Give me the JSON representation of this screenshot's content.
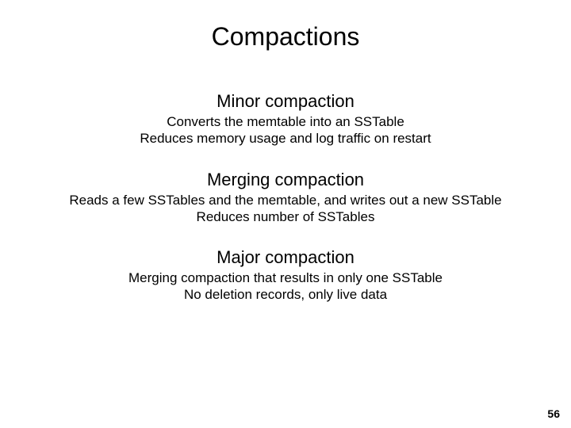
{
  "title": "Compactions",
  "sections": [
    {
      "heading": "Minor compaction",
      "lines": [
        "Converts the memtable into an SSTable",
        "Reduces memory usage and log traffic on restart"
      ]
    },
    {
      "heading": "Merging compaction",
      "lines": [
        "Reads a few SSTables and the memtable, and writes out a new SSTable",
        "Reduces number of SSTables"
      ]
    },
    {
      "heading": "Major compaction",
      "lines": [
        "Merging compaction that results in only one SSTable",
        "No deletion records, only live data"
      ]
    }
  ],
  "page_number": "56"
}
